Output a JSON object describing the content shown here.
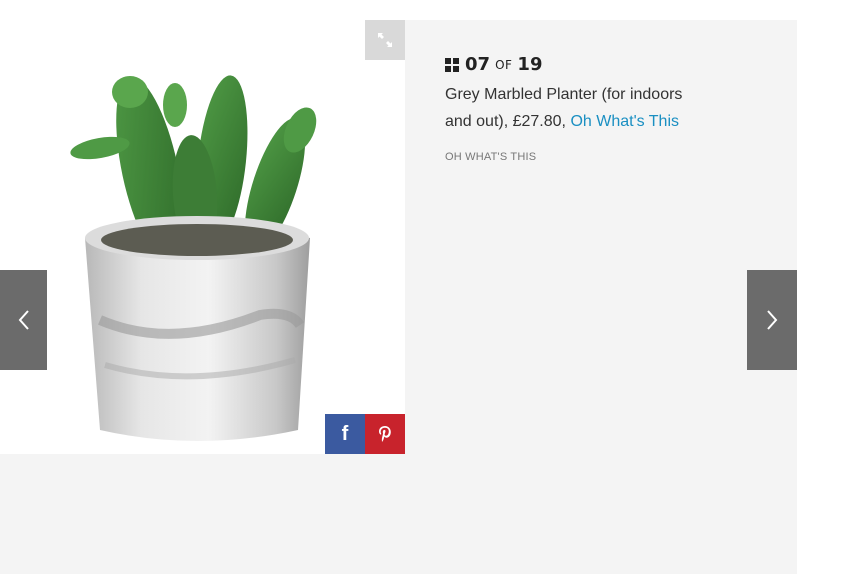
{
  "slide": {
    "current": "07",
    "of_label": "OF",
    "total": "19"
  },
  "caption": {
    "text": "Grey Marbled Planter (for indoors and out), £27.80, ",
    "link_text": "Oh What's This"
  },
  "credit": "OH WHAT'S THIS",
  "icons": {
    "grid": "grid-icon",
    "expand": "expand-icon",
    "facebook": "facebook-icon",
    "pinterest": "pinterest-icon",
    "prev": "chevron-left-icon",
    "next": "chevron-right-icon"
  },
  "colors": {
    "link": "#1a8fc2",
    "facebook": "#3b5aa0",
    "pinterest": "#c8232c",
    "nav": "#6b6b6b"
  }
}
